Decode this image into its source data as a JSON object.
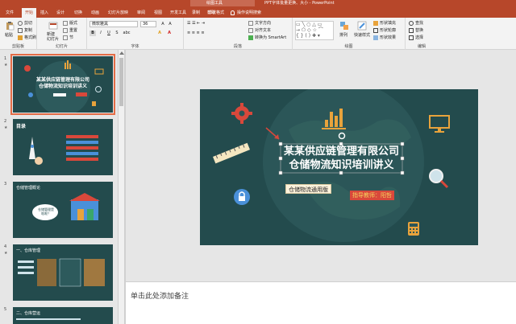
{
  "titlebar": {
    "context_tab": "绘图工具",
    "title": "PPT字体批量更换、大小 - PowerPoint"
  },
  "tabs": [
    "文件",
    "开始",
    "插入",
    "设计",
    "切换",
    "动画",
    "幻灯片放映",
    "审阅",
    "视图",
    "开发工具",
    "录制",
    "帮助",
    "形状格式"
  ],
  "active_tab": "开始",
  "tell_me": "操作说明搜索",
  "ribbon": {
    "clipboard": {
      "paste": "粘贴",
      "cut": "剪切",
      "copy": "复制",
      "format_painter": "格式刷",
      "label": "剪贴板"
    },
    "slides": {
      "new_slide": "新建\n幻灯片",
      "layout": "版式",
      "reset": "重置",
      "section": "节",
      "label": "幻灯片"
    },
    "font": {
      "font_name": "微软雅黑",
      "font_size": "36",
      "bold": "B",
      "italic": "I",
      "underline": "U",
      "strike": "S",
      "shadow": "abc",
      "label": "字体"
    },
    "paragraph": {
      "text_direction": "文字方向",
      "align_text": "对齐文本",
      "smartart": "转换为 SmartArt",
      "label": "段落"
    },
    "drawing": {
      "arrange": "排列",
      "quick_styles": "快速样式",
      "fill": "形状填充",
      "outline": "形状轮廓",
      "effects": "形状效果",
      "label": "绘图"
    },
    "editing": {
      "find": "查找",
      "replace": "替换",
      "select": "选择",
      "label": "编辑"
    }
  },
  "thumbnails": [
    {
      "num": "1",
      "title": "某某供应链管理有限公司",
      "subtitle": "仓储物流知识培训讲义"
    },
    {
      "num": "2",
      "title": "目录"
    },
    {
      "num": "3",
      "title": "仓储管理概论",
      "bubble": "仓储管理是\n啥呢？"
    },
    {
      "num": "4",
      "title": "一、仓库管理"
    },
    {
      "num": "5",
      "title": "二、仓库营运"
    }
  ],
  "slide": {
    "title_line1": "某某供应链管理有限公司",
    "title_line2": "仓储物流知识培训讲义",
    "edition": "仓储物流通用版",
    "teacher_label": "指导教师：",
    "teacher_name": "阳哲"
  },
  "notes_placeholder": "单击此处添加备注",
  "colors": {
    "accent": "#b7472a",
    "slide_bg": "#234b4d",
    "orange": "#e8a33c",
    "red": "#d9483b"
  }
}
